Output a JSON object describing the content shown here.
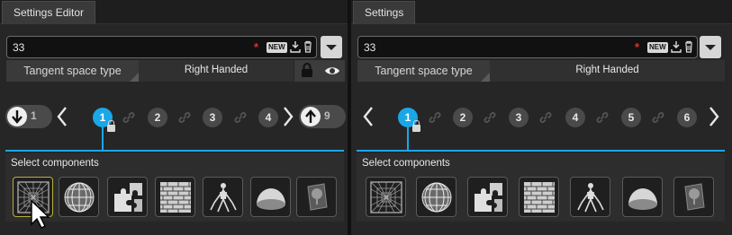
{
  "left": {
    "tab_title": "Settings Editor",
    "field_value": "33",
    "required_mark": "*",
    "new_badge": "NEW",
    "tangent_label": "Tangent space type",
    "tangent_value": "Right Handed",
    "prev_count": "1",
    "next_count": "9",
    "pages": [
      "1",
      "2",
      "3",
      "4"
    ],
    "active_page": "1",
    "components_title": "Select components"
  },
  "right": {
    "tab_title": "Settings",
    "field_value": "33",
    "required_mark": "*",
    "new_badge": "NEW",
    "tangent_label": "Tangent space type",
    "tangent_value": "Right Handed",
    "pages": [
      "1",
      "2",
      "3",
      "4",
      "5",
      "6"
    ],
    "active_page": "1",
    "components_title": "Select components"
  },
  "components": [
    {
      "icon": "grid-warp-icon"
    },
    {
      "icon": "globe-mesh-icon"
    },
    {
      "icon": "puzzle-icon"
    },
    {
      "icon": "brick-wall-icon"
    },
    {
      "icon": "figure-skeleton-icon"
    },
    {
      "icon": "dome-icon"
    },
    {
      "icon": "tree-card-icon"
    }
  ],
  "colors": {
    "accent": "#1aa7e8",
    "selected_outline": "#b9b03a",
    "required": "#e03030"
  }
}
